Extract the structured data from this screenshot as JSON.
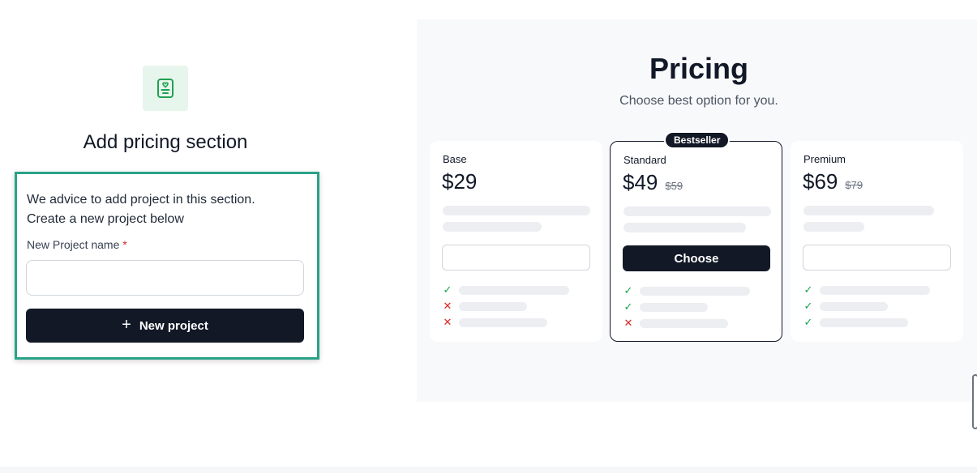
{
  "left": {
    "icon": "pricing-card-icon",
    "title": "Add pricing section",
    "advice_line1": "We advice to add project in this section.",
    "advice_line2": "Create a new project below",
    "field_label": "New Project name",
    "required_mark": "*",
    "input_value": "",
    "button_icon": "plus-icon",
    "button_label": "New project"
  },
  "pricing": {
    "title": "Pricing",
    "subtitle": "Choose best option for you.",
    "badge": "Bestseller",
    "plans": [
      {
        "name": "Base",
        "price": "$29",
        "old_price": "",
        "button_label": "",
        "features": [
          "check",
          "cross",
          "cross"
        ]
      },
      {
        "name": "Standard",
        "price": "$49",
        "old_price": "$59",
        "button_label": "Choose",
        "features": [
          "check",
          "check",
          "cross"
        ]
      },
      {
        "name": "Premium",
        "price": "$69",
        "old_price": "$79",
        "button_label": "",
        "features": [
          "check",
          "check",
          "check"
        ]
      }
    ]
  },
  "colors": {
    "accent_border": "#2aa288",
    "dark_button": "#121826",
    "icon_tile": "#e7f6ec",
    "check": "#16a34a",
    "cross": "#dc2626"
  }
}
